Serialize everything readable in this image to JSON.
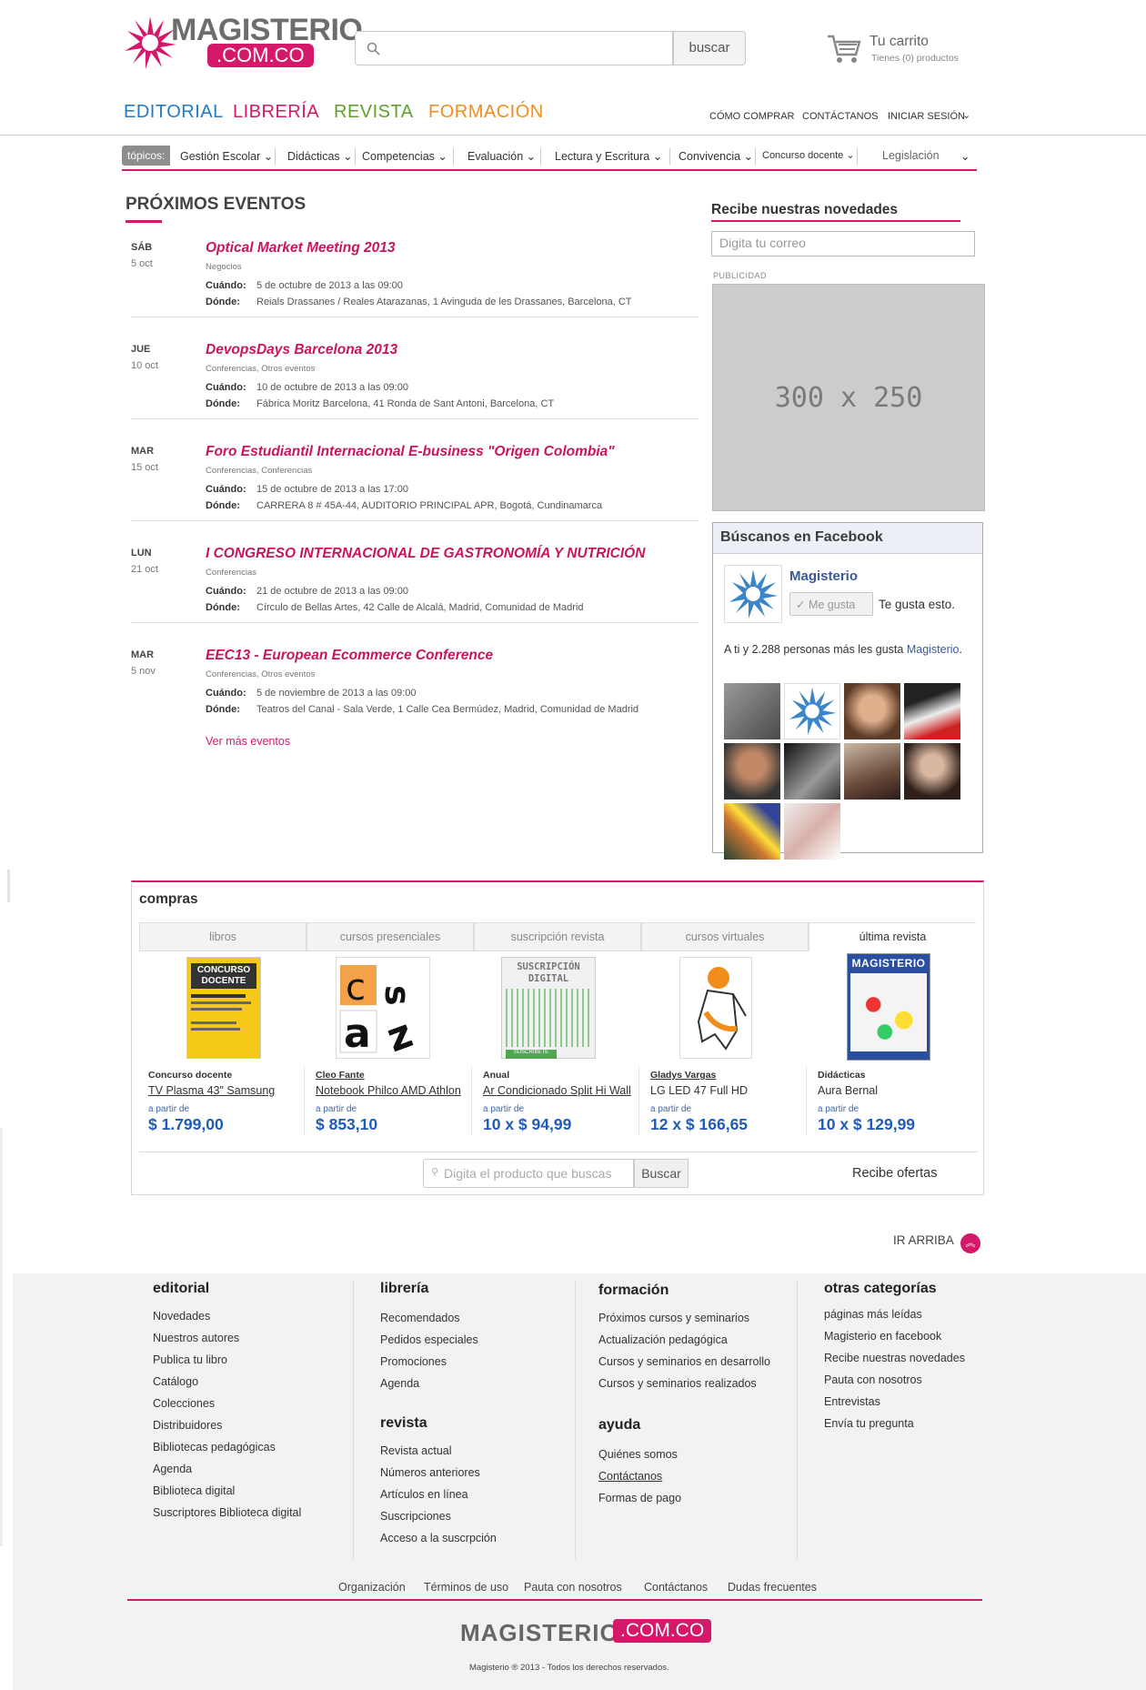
{
  "brand": {
    "name": "MAGISTERIO",
    "domain": ".COM.CO",
    "accent": "#d4196a"
  },
  "search": {
    "button": "buscar"
  },
  "cart": {
    "title": "Tu carrito",
    "subtitle": "Tienes (0) productos"
  },
  "mainnav": [
    {
      "label": "EDITORIAL",
      "color": "#1f7bc9"
    },
    {
      "label": "LIBRERÍA",
      "color": "#d4196a"
    },
    {
      "label": "REVISTA",
      "color": "#5ea12b"
    },
    {
      "label": "FORMACIÓN",
      "color": "#f08d1b"
    }
  ],
  "topnav": [
    "CÓMO COMPRAR",
    "CONTÁCTANOS",
    "INICIAR SESIÓN"
  ],
  "topics": {
    "tag": "tópicos:",
    "items": [
      "Gestión Escolar",
      "Didácticas",
      "Competencias",
      "Evaluación",
      "Lectura y Escritura",
      "Convivencia",
      "Concurso docente",
      "Legislación"
    ]
  },
  "events": {
    "title": "PRÓXIMOS EVENTOS",
    "when_label": "Cuándo:",
    "where_label": "Dónde:",
    "more": "Ver más eventos",
    "items": [
      {
        "day": "SÁB",
        "date": "5 oct",
        "title": "Optical Market Meeting 2013",
        "category": "Negocios",
        "when": "5 de octubre de 2013 a las 09:00",
        "where": "Reials Drassanes / Reales Atarazanas, 1 Avinguda de les Drassanes, Barcelona, CT"
      },
      {
        "day": "JUE",
        "date": "10 oct",
        "title": "DevopsDays Barcelona 2013",
        "category": "Conferencias, Otros eventos",
        "when": "10 de octubre de 2013 a las 09:00",
        "where": "Fábrica Moritz Barcelona, 41 Ronda de Sant Antoni, Barcelona, CT"
      },
      {
        "day": "MAR",
        "date": "15 oct",
        "title": "Foro Estudiantil Internacional E-business \"Origen Colombia\"",
        "category": "Conferencias, Conferencias",
        "when": "15 de octubre de 2013 a las 17:00",
        "where": "CARRERA 8 # 45A-44, AUDITORIO PRINCIPAL APR, Bogotá, Cundinamarca"
      },
      {
        "day": "LUN",
        "date": "21 oct",
        "title": "I CONGRESO INTERNACIONAL DE GASTRONOMÍA Y NUTRICIÓN",
        "category": "Conferencias",
        "when": "21 de octubre de 2013 a las 09:00",
        "where": "Círculo de Bellas Artes, 42 Calle de Alcalá, Madrid, Comunidad de Madrid"
      },
      {
        "day": "MAR",
        "date": "5 nov",
        "title": "EEC13 - European Ecommerce Conference",
        "category": "Conferencias, Otros eventos",
        "when": "5 de noviembre de 2013 a las 09:00",
        "where": "Teatros del Canal - Sala Verde, 1 Calle Cea Bermúdez, Madrid, Comunidad de Madrid"
      }
    ]
  },
  "newsletter": {
    "title": "Recibe nuestras novedades",
    "placeholder": "Digita tu correo"
  },
  "ad": {
    "label": "PUBLICIDAD",
    "size": "300 x 250"
  },
  "facebook": {
    "header": "Búscanos en Facebook",
    "page": "Magisterio",
    "like_button": "Me gusta",
    "like_text": "Te gusta esto.",
    "count_text": "A ti y 2.288 personas más les gusta",
    "count_link": "Magisterio"
  },
  "compras": {
    "title": "compras",
    "tabs": [
      "libros",
      "cursos presenciales",
      "suscripción revista",
      "cursos virtuales",
      "última revista"
    ],
    "products": [
      {
        "category": "Concurso docente",
        "name": "TV Plasma 43\" Samsung",
        "from": "a partir de",
        "price": "$ 1.799,00",
        "cover": "CONCURSO DOCENTE"
      },
      {
        "category": "Cleo Fante",
        "name": "Notebook Philco AMD Athlon",
        "from": "a partir de",
        "price": "$ 853,10",
        "cover": "c a s z"
      },
      {
        "category": "Anual",
        "name": "Ar Condicionado Split Hi Wall",
        "from": "a partir de",
        "price": "10 x $ 94,99",
        "cover": "SUSCRIPCIÓN DIGITAL"
      },
      {
        "category": "Gladys Vargas",
        "name": "LG LED 47 Full HD",
        "from": "a partir de",
        "price": "12 x $ 166,65",
        "cover": ""
      },
      {
        "category": "Didácticas",
        "name": "Aura Bernal",
        "from": "a partir de",
        "price": "10 x $ 129,99",
        "cover": "MAGISTERIO"
      }
    ],
    "search_placeholder": "Digita el producto que buscas",
    "search_button": "Buscar",
    "offers": "Recibe ofertas"
  },
  "ir_arriba": "IR ARRIBA",
  "footer": {
    "editorial": {
      "title": "editorial",
      "links": [
        "Novedades",
        "Nuestros autores",
        "Publica tu libro",
        "Catálogo",
        "Colecciones",
        "Distribuidores",
        "Bibliotecas pedagógicas",
        "Agenda",
        "Biblioteca digital",
        "Suscriptores Biblioteca digital"
      ]
    },
    "libreria": {
      "title": "librería",
      "links": [
        "Recomendados",
        "Pedidos especiales",
        "Promociones",
        "Agenda"
      ]
    },
    "revista": {
      "title": "revista",
      "links": [
        "Revista actual",
        "Números anteriores",
        "Artículos en línea",
        "Suscripciones",
        "Acceso a la suscrpción"
      ]
    },
    "formacion": {
      "title": "formación",
      "links": [
        "Próximos cursos y seminarios",
        "Actualización pedagógica",
        "Cursos y seminarios en desarrollo",
        "Cursos y seminarios realizados"
      ]
    },
    "ayuda": {
      "title": "ayuda",
      "links": [
        "Quiénes somos",
        "Contáctanos",
        "Formas de pago"
      ]
    },
    "otras": {
      "title": "otras categorías",
      "links": [
        "páginas más leídas",
        "Magisterio en facebook",
        "Recibe nuestras novedades",
        "Pauta con nosotros",
        "Entrevistas",
        "Envía tu pregunta"
      ]
    },
    "bottom_links": [
      "Organización",
      "Términos de uso",
      "Pauta con nosotros",
      "Contáctanos",
      "Dudas frecuentes"
    ],
    "copyright": "Magisterio ® 2013 - Todos los derechos reservados."
  }
}
